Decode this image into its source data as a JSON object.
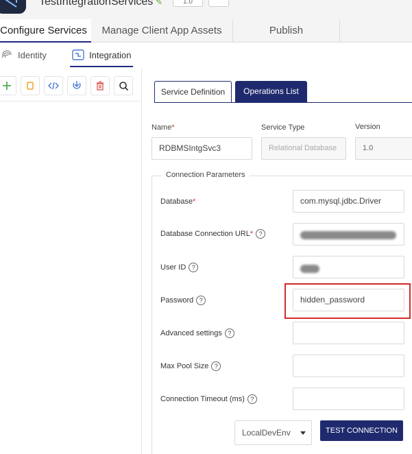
{
  "header": {
    "app_title": "TestIntegrationServices",
    "version_pill": "1.0"
  },
  "main_tabs": [
    {
      "label": "Configure Services"
    },
    {
      "label": "Manage Client App Assets"
    },
    {
      "label": "Publish"
    }
  ],
  "sub_tabs": [
    {
      "label": "Identity",
      "icon": "fingerprint-icon"
    },
    {
      "label": "Integration",
      "icon": "integration-icon"
    }
  ],
  "toolbar": {
    "icons": [
      "plus-icon",
      "copy-icon",
      "code-icon",
      "import-icon",
      "delete-icon",
      "search-icon"
    ]
  },
  "definition_tabs": [
    {
      "label": "Service Definition"
    },
    {
      "label": "Operations List"
    }
  ],
  "service": {
    "name_label": "Name",
    "name_value": "RDBMSIntgSvc3",
    "type_label": "Service Type",
    "type_value": "Relational Database",
    "version_label": "Version",
    "version_value": "1.0"
  },
  "connection": {
    "legend": "Connection Parameters",
    "database_label": "Database",
    "database_value": "com.mysql.jdbc.Driver",
    "url_label": "Database Connection URL",
    "userid_label": "User ID",
    "password_label": "Password",
    "password_value": "hidden_password",
    "advanced_label": "Advanced settings",
    "pool_label": "Max Pool Size",
    "timeout_label": "Connection Timeout (ms)",
    "help_glyph": "?"
  },
  "footer": {
    "env_select": "LocalDevEnv",
    "test_button": "TEST CONNECTION"
  },
  "colors": {
    "navy": "#1f2a6e",
    "highlight_red": "#d42a2a",
    "required_red": "#c0392b"
  }
}
